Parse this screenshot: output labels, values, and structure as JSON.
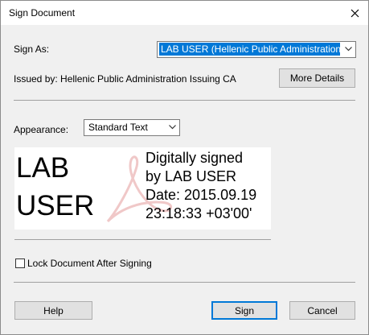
{
  "window": {
    "title": "Sign Document"
  },
  "sign_as": {
    "label": "Sign As:",
    "selected": "LAB USER (Hellenic Public Administration Issuing CA)"
  },
  "issued_by": {
    "text": "Issued by: Hellenic Public Administration Issuing CA",
    "more_details_label": "More Details"
  },
  "appearance": {
    "label": "Appearance:",
    "selected": "Standard Text"
  },
  "signature_preview": {
    "name_line1": "LAB",
    "name_line2": "USER",
    "details": [
      "Digitally signed",
      "by LAB USER",
      "Date: 2015.09.19",
      "23:18:33 +03'00'"
    ]
  },
  "lock": {
    "label": "Lock Document After Signing",
    "checked": false
  },
  "buttons": {
    "help": "Help",
    "sign": "Sign",
    "cancel": "Cancel"
  },
  "colors": {
    "selection": "#0078d7",
    "watermark": "#f0c8c8"
  },
  "icons": [
    "close-icon",
    "chevron-down-icon",
    "adobe-watermark-icon"
  ]
}
